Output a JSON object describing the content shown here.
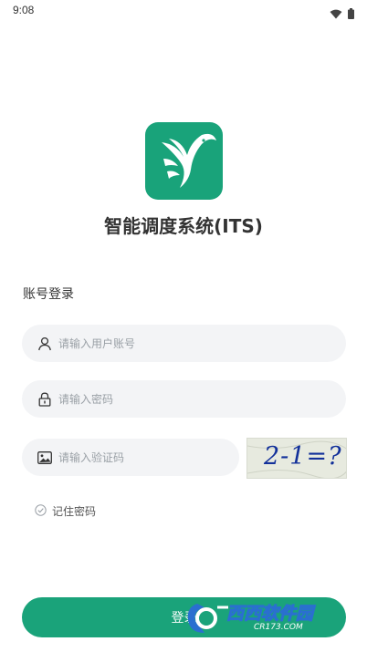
{
  "status_bar": {
    "time": "9:08"
  },
  "app": {
    "title": "智能调度系统(ITS)"
  },
  "login": {
    "section_label": "账号登录",
    "username": {
      "placeholder": "请输入用户账号",
      "icon": "user-icon"
    },
    "password": {
      "placeholder": "请输入密码",
      "icon": "lock-icon"
    },
    "captcha": {
      "placeholder": "请输入验证码",
      "icon": "image-icon",
      "challenge_text": "2-1=?"
    },
    "remember_label": "记住密码",
    "submit_label": "登录"
  },
  "watermark": {
    "brand": "西西软件园",
    "domain": "CR173.COM"
  },
  "colors": {
    "brand_green": "#19a37a",
    "field_bg": "#f3f4f6",
    "placeholder": "#9aa0a6"
  }
}
